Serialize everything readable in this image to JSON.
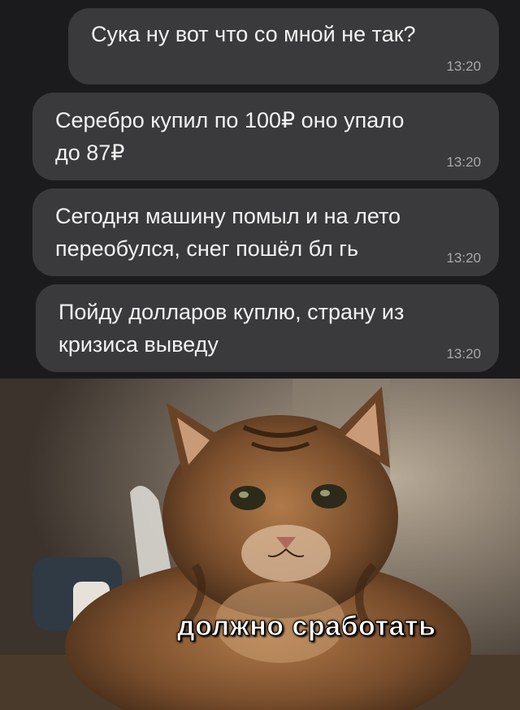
{
  "messages": [
    {
      "text": "Сука ну вот что со мной не так?",
      "time": "13:20"
    },
    {
      "text": "Серебро купил по 100₽ оно упало\nдо 87₽",
      "time": "13:20"
    },
    {
      "text": "Сегодня машину помыл и на лето\nпереобулся, снег пошёл бл гь",
      "time": "13:20"
    },
    {
      "text": "Пойду долларов куплю, страну из\nкризиса выведу",
      "time": "13:20"
    }
  ],
  "meme": {
    "caption": "должно сработать"
  },
  "colors": {
    "chat_bg": "#1b1b1d",
    "bubble_bg": "#3a3a3c",
    "text": "#f2f2f2",
    "time": "#a8a8ad"
  }
}
